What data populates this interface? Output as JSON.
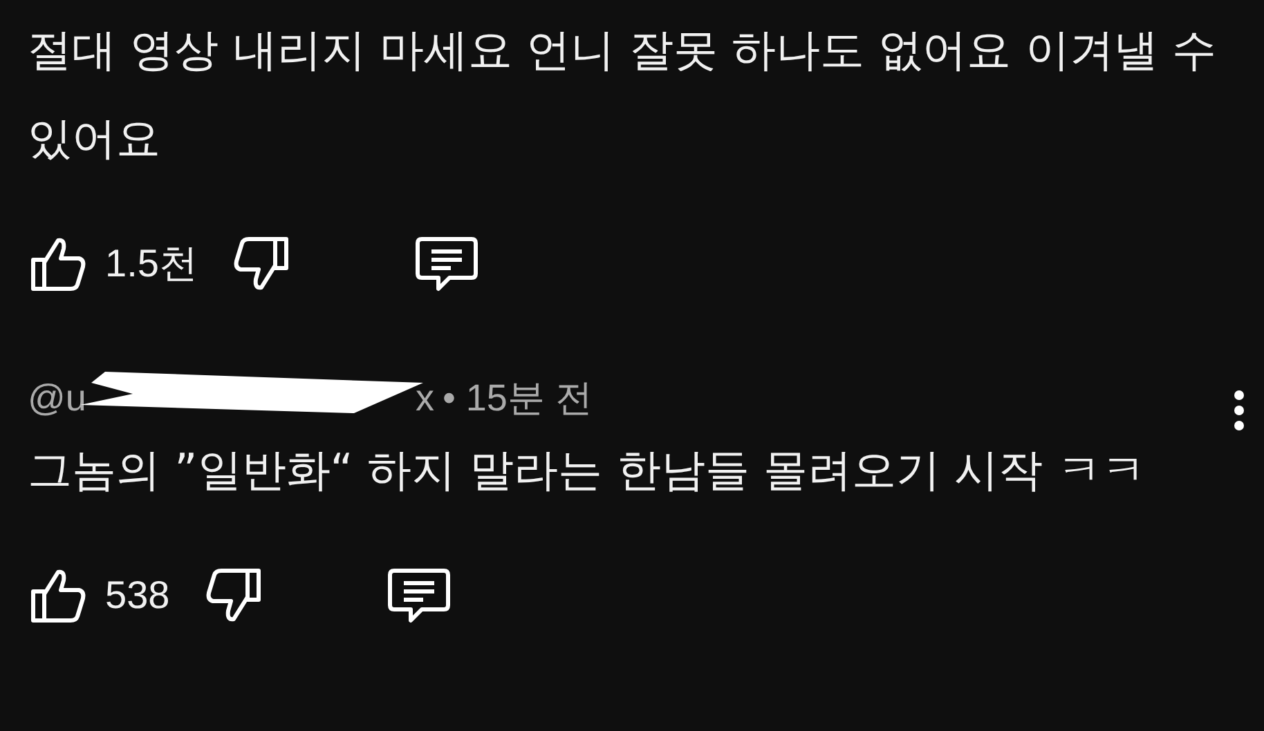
{
  "comments": [
    {
      "menu": false,
      "text": "절대 영상 내리지 마세요 언니 잘못 하나도 없어요 이겨낼 수 있어요",
      "likes": "1.5천"
    },
    {
      "handle_start": "@u",
      "handle_end": "x",
      "time": "• 15분 전",
      "menu": true,
      "text": "그놈의 ”일반화“ 하지 말라는 한남들 몰려오기 시작 ㅋㅋ",
      "likes": "538"
    }
  ]
}
